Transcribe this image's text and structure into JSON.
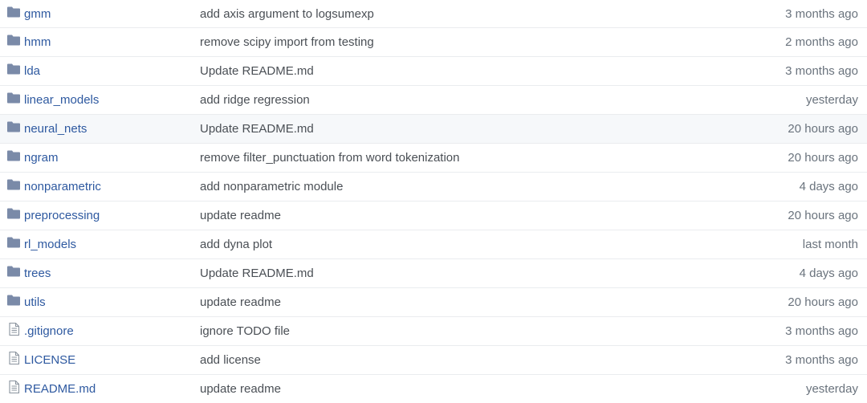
{
  "colors": {
    "link": "#2e59a0",
    "folder_icon": "#7a8aa8",
    "file_icon": "#8a939e",
    "message": "#4a4f55",
    "age": "#6a737d",
    "hover_row": "#f6f8fa",
    "border": "#eaecef"
  },
  "files": [
    {
      "type": "folder",
      "icon": "folder-icon",
      "name": "gmm",
      "message": "add axis argument to logsumexp",
      "age": "3 months ago"
    },
    {
      "type": "folder",
      "icon": "folder-icon",
      "name": "hmm",
      "message": "remove scipy import from testing",
      "age": "2 months ago"
    },
    {
      "type": "folder",
      "icon": "folder-icon",
      "name": "lda",
      "message": "Update README.md",
      "age": "3 months ago"
    },
    {
      "type": "folder",
      "icon": "folder-icon",
      "name": "linear_models",
      "message": "add ridge regression",
      "age": "yesterday"
    },
    {
      "type": "folder",
      "icon": "folder-icon",
      "name": "neural_nets",
      "message": "Update README.md",
      "age": "20 hours ago",
      "hovered": true
    },
    {
      "type": "folder",
      "icon": "folder-icon",
      "name": "ngram",
      "message": "remove filter_punctuation from word tokenization",
      "age": "20 hours ago"
    },
    {
      "type": "folder",
      "icon": "folder-icon",
      "name": "nonparametric",
      "message": "add nonparametric module",
      "age": "4 days ago"
    },
    {
      "type": "folder",
      "icon": "folder-icon",
      "name": "preprocessing",
      "message": "update readme",
      "age": "20 hours ago"
    },
    {
      "type": "folder",
      "icon": "folder-icon",
      "name": "rl_models",
      "message": "add dyna plot",
      "age": "last month"
    },
    {
      "type": "folder",
      "icon": "folder-icon",
      "name": "trees",
      "message": "Update README.md",
      "age": "4 days ago"
    },
    {
      "type": "folder",
      "icon": "folder-icon",
      "name": "utils",
      "message": "update readme",
      "age": "20 hours ago"
    },
    {
      "type": "file",
      "icon": "file-text-icon",
      "name": ".gitignore",
      "message": "ignore TODO file",
      "age": "3 months ago"
    },
    {
      "type": "file",
      "icon": "file-text-icon",
      "name": "LICENSE",
      "message": "add license",
      "age": "3 months ago"
    },
    {
      "type": "file",
      "icon": "file-text-icon",
      "name": "README.md",
      "message": "update readme",
      "age": "yesterday"
    }
  ]
}
